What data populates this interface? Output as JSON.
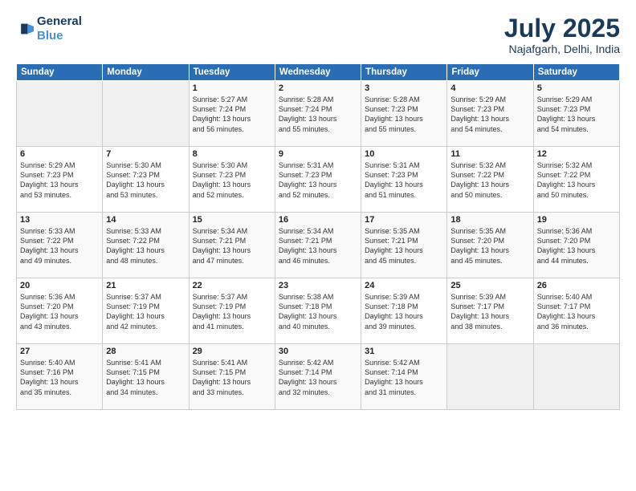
{
  "header": {
    "logo_line1": "General",
    "logo_line2": "Blue",
    "title": "July 2025",
    "subtitle": "Najafgarh, Delhi, India"
  },
  "weekdays": [
    "Sunday",
    "Monday",
    "Tuesday",
    "Wednesday",
    "Thursday",
    "Friday",
    "Saturday"
  ],
  "weeks": [
    [
      {
        "day": "",
        "info": ""
      },
      {
        "day": "",
        "info": ""
      },
      {
        "day": "1",
        "info": "Sunrise: 5:27 AM\nSunset: 7:24 PM\nDaylight: 13 hours\nand 56 minutes."
      },
      {
        "day": "2",
        "info": "Sunrise: 5:28 AM\nSunset: 7:24 PM\nDaylight: 13 hours\nand 55 minutes."
      },
      {
        "day": "3",
        "info": "Sunrise: 5:28 AM\nSunset: 7:23 PM\nDaylight: 13 hours\nand 55 minutes."
      },
      {
        "day": "4",
        "info": "Sunrise: 5:29 AM\nSunset: 7:23 PM\nDaylight: 13 hours\nand 54 minutes."
      },
      {
        "day": "5",
        "info": "Sunrise: 5:29 AM\nSunset: 7:23 PM\nDaylight: 13 hours\nand 54 minutes."
      }
    ],
    [
      {
        "day": "6",
        "info": "Sunrise: 5:29 AM\nSunset: 7:23 PM\nDaylight: 13 hours\nand 53 minutes."
      },
      {
        "day": "7",
        "info": "Sunrise: 5:30 AM\nSunset: 7:23 PM\nDaylight: 13 hours\nand 53 minutes."
      },
      {
        "day": "8",
        "info": "Sunrise: 5:30 AM\nSunset: 7:23 PM\nDaylight: 13 hours\nand 52 minutes."
      },
      {
        "day": "9",
        "info": "Sunrise: 5:31 AM\nSunset: 7:23 PM\nDaylight: 13 hours\nand 52 minutes."
      },
      {
        "day": "10",
        "info": "Sunrise: 5:31 AM\nSunset: 7:23 PM\nDaylight: 13 hours\nand 51 minutes."
      },
      {
        "day": "11",
        "info": "Sunrise: 5:32 AM\nSunset: 7:22 PM\nDaylight: 13 hours\nand 50 minutes."
      },
      {
        "day": "12",
        "info": "Sunrise: 5:32 AM\nSunset: 7:22 PM\nDaylight: 13 hours\nand 50 minutes."
      }
    ],
    [
      {
        "day": "13",
        "info": "Sunrise: 5:33 AM\nSunset: 7:22 PM\nDaylight: 13 hours\nand 49 minutes."
      },
      {
        "day": "14",
        "info": "Sunrise: 5:33 AM\nSunset: 7:22 PM\nDaylight: 13 hours\nand 48 minutes."
      },
      {
        "day": "15",
        "info": "Sunrise: 5:34 AM\nSunset: 7:21 PM\nDaylight: 13 hours\nand 47 minutes."
      },
      {
        "day": "16",
        "info": "Sunrise: 5:34 AM\nSunset: 7:21 PM\nDaylight: 13 hours\nand 46 minutes."
      },
      {
        "day": "17",
        "info": "Sunrise: 5:35 AM\nSunset: 7:21 PM\nDaylight: 13 hours\nand 45 minutes."
      },
      {
        "day": "18",
        "info": "Sunrise: 5:35 AM\nSunset: 7:20 PM\nDaylight: 13 hours\nand 45 minutes."
      },
      {
        "day": "19",
        "info": "Sunrise: 5:36 AM\nSunset: 7:20 PM\nDaylight: 13 hours\nand 44 minutes."
      }
    ],
    [
      {
        "day": "20",
        "info": "Sunrise: 5:36 AM\nSunset: 7:20 PM\nDaylight: 13 hours\nand 43 minutes."
      },
      {
        "day": "21",
        "info": "Sunrise: 5:37 AM\nSunset: 7:19 PM\nDaylight: 13 hours\nand 42 minutes."
      },
      {
        "day": "22",
        "info": "Sunrise: 5:37 AM\nSunset: 7:19 PM\nDaylight: 13 hours\nand 41 minutes."
      },
      {
        "day": "23",
        "info": "Sunrise: 5:38 AM\nSunset: 7:18 PM\nDaylight: 13 hours\nand 40 minutes."
      },
      {
        "day": "24",
        "info": "Sunrise: 5:39 AM\nSunset: 7:18 PM\nDaylight: 13 hours\nand 39 minutes."
      },
      {
        "day": "25",
        "info": "Sunrise: 5:39 AM\nSunset: 7:17 PM\nDaylight: 13 hours\nand 38 minutes."
      },
      {
        "day": "26",
        "info": "Sunrise: 5:40 AM\nSunset: 7:17 PM\nDaylight: 13 hours\nand 36 minutes."
      }
    ],
    [
      {
        "day": "27",
        "info": "Sunrise: 5:40 AM\nSunset: 7:16 PM\nDaylight: 13 hours\nand 35 minutes."
      },
      {
        "day": "28",
        "info": "Sunrise: 5:41 AM\nSunset: 7:15 PM\nDaylight: 13 hours\nand 34 minutes."
      },
      {
        "day": "29",
        "info": "Sunrise: 5:41 AM\nSunset: 7:15 PM\nDaylight: 13 hours\nand 33 minutes."
      },
      {
        "day": "30",
        "info": "Sunrise: 5:42 AM\nSunset: 7:14 PM\nDaylight: 13 hours\nand 32 minutes."
      },
      {
        "day": "31",
        "info": "Sunrise: 5:42 AM\nSunset: 7:14 PM\nDaylight: 13 hours\nand 31 minutes."
      },
      {
        "day": "",
        "info": ""
      },
      {
        "day": "",
        "info": ""
      }
    ]
  ]
}
